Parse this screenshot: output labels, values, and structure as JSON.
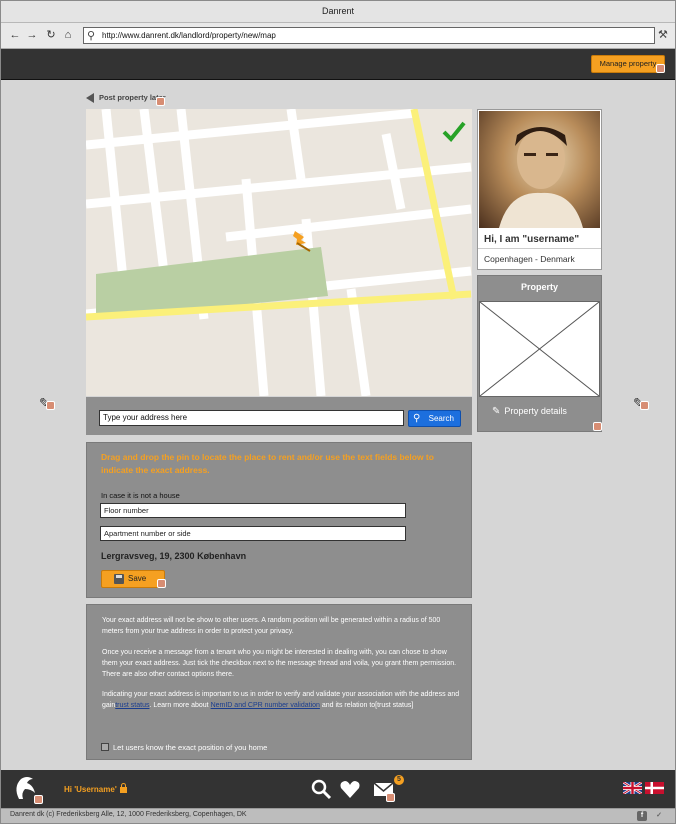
{
  "window": {
    "title": "Danrent"
  },
  "browser": {
    "url": "http://www.danrent.dk/landlord/property/new/map"
  },
  "header": {
    "manage_label": "Manage property"
  },
  "back_link": {
    "label": "Post property later"
  },
  "search": {
    "placeholder": "Type your address here",
    "button_label": "Search"
  },
  "location_form": {
    "instructions": "Drag and drop the pin to locate the place to rent and/or use the text fields below to indicate the exact address.",
    "house_label": "In case it is not a house",
    "floor_placeholder": "Floor number",
    "apartment_placeholder": "Apartment number or side",
    "address": "Lergravsveg, 19, 2300 København",
    "save_label": "Save"
  },
  "privacy": {
    "p1": "Your exact address will not be show to other users. A random position will be generated within a radius of 500 meters from your true address in order to protect your privacy.",
    "p2": "Once you receive a message from a tenant who you might be interested in dealing with, you can chose to show them your exact address. Just tick the checkbox next to the message thread and voila, you grant them permission. There are also other contact options there.",
    "p3_pre": "Indicating your exact address is important to us in order to verify and validate your association with the address and gain",
    "p3_link1": "trust status",
    "p3_mid": ". Learn more about",
    "p3_link2": "NemID and CPR number validation",
    "p3_post": "and its relation to[trust status]",
    "checkbox_label": "Let users know the exact position of you home"
  },
  "profile": {
    "greeting": "Hi, I am \"username\"",
    "location": "Copenhagen - Denmark"
  },
  "property_card": {
    "title": "Property",
    "details_label": "Property details"
  },
  "footer": {
    "user_greeting": "Hi 'Username'",
    "message_count": "5",
    "copyright": "Danrent dk (c) Frederiksberg Alle, 12, 1000 Frederiksberg, Copenhagen, DK"
  },
  "colors": {
    "accent": "#f5a021",
    "search_blue": "#1c6fde",
    "panel_gray": "#8e8e8e",
    "bar_dark": "#333333"
  },
  "icons": [
    "back-arrow-icon",
    "forward-arrow-icon",
    "reload-icon",
    "home-icon",
    "search-icon",
    "wrench-icon",
    "checkmark-icon",
    "map-pin-icon",
    "pencil-icon",
    "heart-icon",
    "mail-icon",
    "lock-icon",
    "uk-flag-icon",
    "denmark-flag-icon",
    "facebook-icon",
    "twitter-icon"
  ]
}
